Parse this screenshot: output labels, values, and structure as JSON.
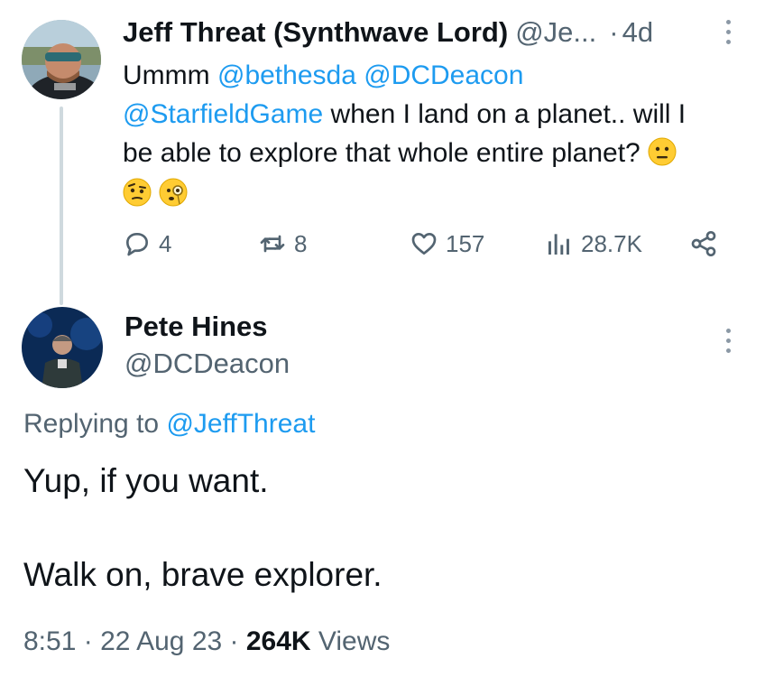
{
  "tweet1": {
    "name": "Jeff Threat (Synthwave Lord)",
    "handle": "@Je...",
    "dot": "·",
    "time": "4d",
    "line1_prefix": "Ummm ",
    "mention1": "@bethesda",
    "mention2": "@DCDeacon",
    "mention3": "@StarfieldGame",
    "line2_rest": " when I land on a planet.. will I",
    "line3": "be able to explore that whole entire planet?",
    "emojis": [
      "neutral-face",
      "raised-eyebrow-face",
      "face-with-monocle"
    ],
    "actions": {
      "replies": "4",
      "retweets": "8",
      "likes": "157",
      "views": "28.7K"
    }
  },
  "tweet2": {
    "name": "Pete Hines",
    "handle": "@DCDeacon",
    "replying_prefix": "Replying to ",
    "replying_to": "@JeffThreat",
    "text_line1": "Yup, if you want.",
    "text_line2": "Walk on, brave explorer.",
    "time": "8:51",
    "sep1": " · ",
    "date": "22 Aug 23",
    "sep2": " · ",
    "views_count": "264K",
    "views_label": " Views"
  },
  "icons": [
    "reply-icon",
    "retweet-icon",
    "like-icon",
    "views-icon",
    "share-icon",
    "more-icon"
  ],
  "colors": {
    "link": "#1d9bf0",
    "secondary": "#536471",
    "primary": "#0f1419",
    "thread_line": "#cfd9de"
  }
}
